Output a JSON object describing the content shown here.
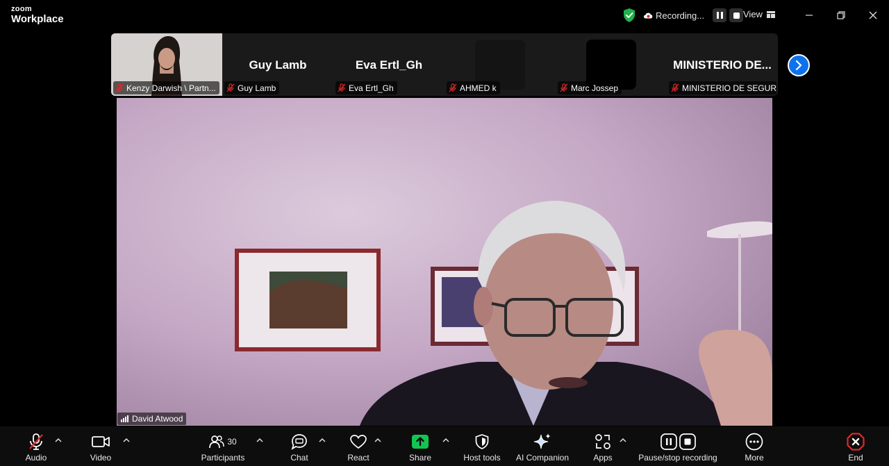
{
  "app": {
    "brand_small": "zoom",
    "brand_big": "Workplace"
  },
  "titlebar": {
    "recording_label": "Recording...",
    "view_label": "View"
  },
  "participants_strip": [
    {
      "name": "Kenzy Darwish \\ Partn...",
      "type": "video"
    },
    {
      "name": "Guy Lamb",
      "display": "Guy Lamb",
      "type": "name"
    },
    {
      "name": "Eva Ertl_Gh",
      "display": "Eva Ertl_Gh",
      "type": "name"
    },
    {
      "name": "AHMED k",
      "type": "avatar",
      "avatar_color": "#141414"
    },
    {
      "name": "Marc Jossep",
      "type": "avatar",
      "avatar_color": "#000000"
    },
    {
      "name": "MINISTERIO DE SEGUR...",
      "display": "MINISTERIO  DE...",
      "type": "name"
    }
  ],
  "main_video": {
    "speaker": "David Atwood"
  },
  "toolbar": {
    "audio": "Audio",
    "video": "Video",
    "participants": "Participants",
    "participants_count": "30",
    "chat": "Chat",
    "react": "React",
    "share": "Share",
    "host_tools": "Host tools",
    "ai_companion": "AI Companion",
    "apps": "Apps",
    "pause_stop_recording": "Pause/stop recording",
    "more": "More",
    "end": "End"
  },
  "colors": {
    "share_green": "#12c552",
    "end_red": "#e02828",
    "muted_red": "#e02828",
    "next_blue": "#0e72ed",
    "shield_green": "#22b14c"
  }
}
